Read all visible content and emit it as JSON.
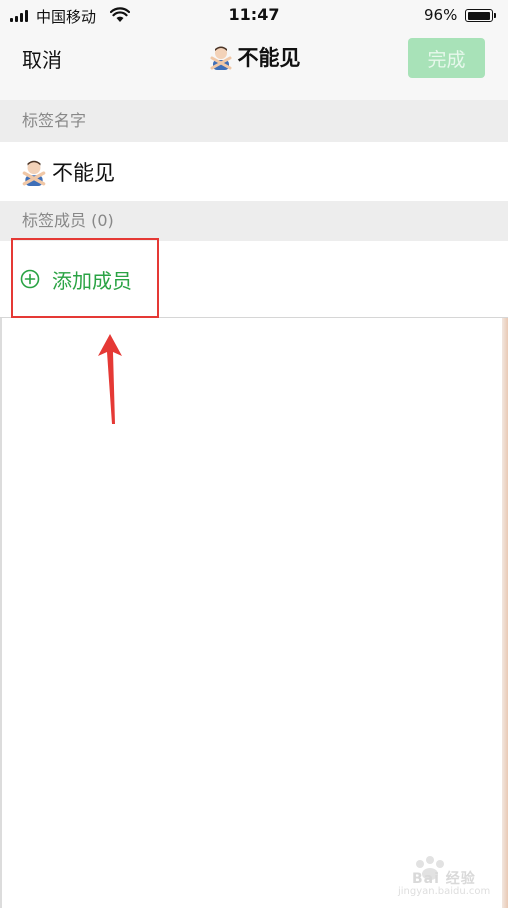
{
  "status_bar": {
    "carrier": "中国移动",
    "time": "11:47",
    "battery_percent": "96%",
    "battery_level": 0.96
  },
  "nav": {
    "cancel_label": "取消",
    "title_emoji": "man-gesturing-no-icon",
    "title": "不能见",
    "done_label": "完成",
    "done_enabled": false,
    "accent_color": "#a8e2b8"
  },
  "sections": {
    "tag_name_header": "标签名字",
    "tag_members_header": "标签成员 (0)"
  },
  "tag_name_row": {
    "emoji": "man-gesturing-no-icon",
    "value": "不能见"
  },
  "members": {
    "add_label": "添加成员",
    "add_icon": "plus-circle-icon",
    "accent_color": "#2aa344"
  },
  "annotations": {
    "highlight_color": "#e53935",
    "arrow_color": "#e53935"
  },
  "watermark": {
    "text": "Bai 经验",
    "url": "jingyan.baidu.com"
  }
}
